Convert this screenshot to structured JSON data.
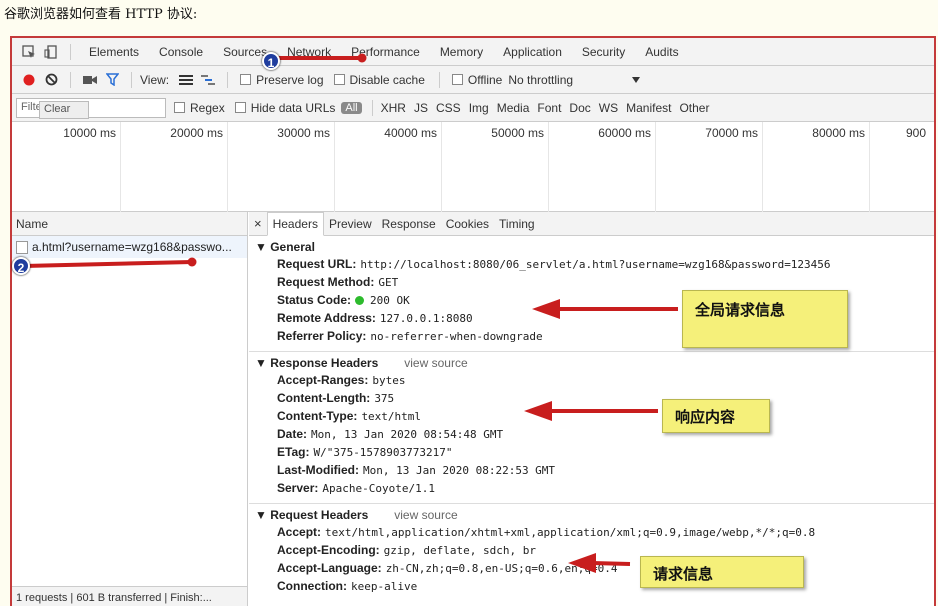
{
  "caption": "谷歌浏览器如何查看 HTTP 协议:",
  "tabs": [
    "Elements",
    "Console",
    "Sources",
    "Network",
    "Performance",
    "Memory",
    "Application",
    "Security",
    "Audits"
  ],
  "toolbar": {
    "view_label": "View:",
    "preserve_log": "Preserve log",
    "disable_cache": "Disable cache",
    "offline": "Offline",
    "throttling": "No throttling"
  },
  "filter": {
    "placeholder": "Filter",
    "clear_tip": "Clear",
    "regex": "Regex",
    "hide_data_urls": "Hide data URLs",
    "all": "All",
    "types": [
      "XHR",
      "JS",
      "CSS",
      "Img",
      "Media",
      "Font",
      "Doc",
      "WS",
      "Manifest",
      "Other"
    ]
  },
  "timeline_ticks": [
    "10000 ms",
    "20000 ms",
    "30000 ms",
    "40000 ms",
    "50000 ms",
    "60000 ms",
    "70000 ms",
    "80000 ms",
    "900"
  ],
  "name_column": {
    "header": "Name",
    "request": "a.html?username=wzg168&passwo...",
    "status": "1 requests | 601 B transferred | Finish:..."
  },
  "detail_tabs": [
    "×",
    "Headers",
    "Preview",
    "Response",
    "Cookies",
    "Timing"
  ],
  "general": {
    "title": "General",
    "rows": [
      {
        "k": "Request URL:",
        "v": "http://localhost:8080/06_servlet/a.html?username=wzg168&password=123456"
      },
      {
        "k": "Request Method:",
        "v": "GET"
      },
      {
        "k": "Status Code:",
        "v": "200 OK"
      },
      {
        "k": "Remote Address:",
        "v": "127.0.0.1:8080"
      },
      {
        "k": "Referrer Policy:",
        "v": "no-referrer-when-downgrade"
      }
    ]
  },
  "response_headers": {
    "title": "Response Headers",
    "view_source": "view source",
    "rows": [
      {
        "k": "Accept-Ranges:",
        "v": "bytes"
      },
      {
        "k": "Content-Length:",
        "v": "375"
      },
      {
        "k": "Content-Type:",
        "v": "text/html"
      },
      {
        "k": "Date:",
        "v": "Mon, 13 Jan 2020 08:54:48 GMT"
      },
      {
        "k": "ETag:",
        "v": "W/\"375-1578903773217\""
      },
      {
        "k": "Last-Modified:",
        "v": "Mon, 13 Jan 2020 08:22:53 GMT"
      },
      {
        "k": "Server:",
        "v": "Apache-Coyote/1.1"
      }
    ]
  },
  "request_headers": {
    "title": "Request Headers",
    "view_source": "view source",
    "rows": [
      {
        "k": "Accept:",
        "v": "text/html,application/xhtml+xml,application/xml;q=0.9,image/webp,*/*;q=0.8"
      },
      {
        "k": "Accept-Encoding:",
        "v": "gzip, deflate, sdch, br"
      },
      {
        "k": "Accept-Language:",
        "v": "zh-CN,zh;q=0.8,en-US;q=0.6,en;q=0.4"
      },
      {
        "k": "Connection:",
        "v": "keep-alive"
      }
    ]
  },
  "annotations": {
    "badge1": "1",
    "badge2": "2",
    "note_general": "全局请求信息",
    "note_response": "响应内容",
    "note_request": "请求信息"
  },
  "colors": {
    "record": "#e02020",
    "arrow": "#c81e1e",
    "note_bg": "#f5f07a",
    "badge": "#1f3d9e",
    "frame": "#c43a3a"
  }
}
